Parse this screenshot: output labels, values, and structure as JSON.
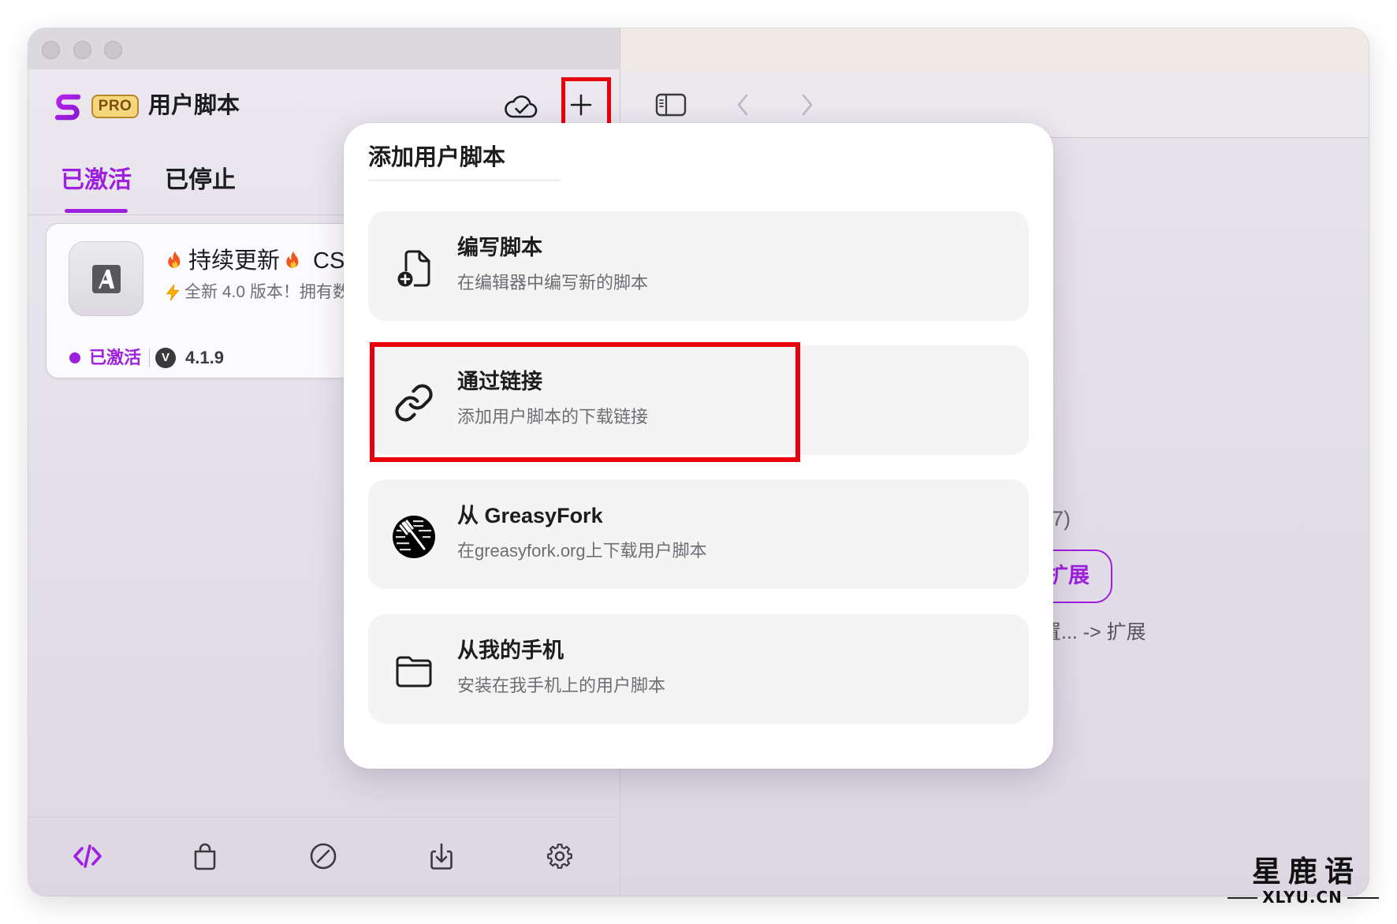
{
  "colors": {
    "accent": "#9e1fde",
    "highlight_red": "#e8000b",
    "text_primary": "#1d1d1f",
    "text_secondary": "#6e6e73",
    "pro_badge": "#f5d77e"
  },
  "sidebar": {
    "logo_icon": "stay-logo-icon",
    "badge": "PRO",
    "app_name": "用户脚本",
    "header_icons": {
      "sync": "cloud-check-icon",
      "add": "plus-icon"
    },
    "tabs": [
      {
        "label": "已激活",
        "active": true
      },
      {
        "label": "已停止",
        "active": false
      }
    ],
    "script_card": {
      "icon": "script-app-icon",
      "title_emoji_icon": "fire-icon",
      "title": "持续更新",
      "title_trailing": "CS",
      "subtitle_emoji_icon": "lightning-icon",
      "subtitle": "全新 4.0 版本！拥有数",
      "status": "已激活",
      "version_badge": "V",
      "version": "4.1.9"
    },
    "bottom_tabs": [
      {
        "icon": "code-icon",
        "active": true
      },
      {
        "icon": "bag-icon",
        "active": false
      },
      {
        "icon": "slash-circle-icon",
        "active": false
      },
      {
        "icon": "download-icon",
        "active": false
      },
      {
        "icon": "gear-icon",
        "active": false
      }
    ]
  },
  "detail_pane": {
    "toolbar_icons": [
      "sidebar-toggle-icon",
      "chevron-left-icon",
      "chevron-right-icon"
    ],
    "partial_text": "7)",
    "button_label": "扩展",
    "hint_text": "置... -> 扩展"
  },
  "popup": {
    "title": "添加用户脚本",
    "options": [
      {
        "icon": "new-document-icon",
        "title": "编写脚本",
        "subtitle": "在编辑器中编写新的脚本",
        "highlighted": false
      },
      {
        "icon": "link-icon",
        "title": "通过链接",
        "subtitle": "添加用户脚本的下载链接",
        "highlighted": true
      },
      {
        "icon": "greasyfork-logo-icon",
        "title": "从 GreasyFork",
        "subtitle": "在greasyfork.org上下载用户脚本",
        "highlighted": false
      },
      {
        "icon": "folder-icon",
        "title": "从我的手机",
        "subtitle": "安装在我手机上的用户脚本",
        "highlighted": false
      }
    ]
  },
  "watermark": {
    "name": "星鹿语",
    "domain": "XLYU.CN"
  }
}
